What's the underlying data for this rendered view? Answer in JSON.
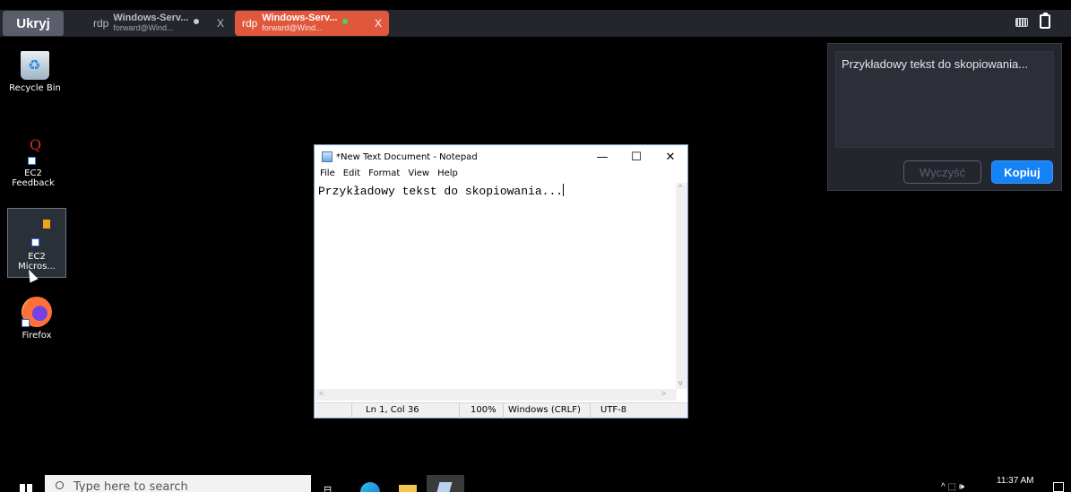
{
  "topbar": {
    "hide_label": "Ukryj",
    "tabs": [
      {
        "protocol": "rdp",
        "title": "Windows-Serv...",
        "subtitle": "forward@Wind...",
        "close": "X",
        "active": false
      },
      {
        "protocol": "rdp",
        "title": "Windows-Serv...",
        "subtitle": "forward@Wind...",
        "close": "X",
        "active": true
      }
    ],
    "colors": {
      "bar": "#24262d",
      "active_tab": "#e0573c",
      "connected_dot": "#3ed66a"
    }
  },
  "desktop": {
    "icons": [
      {
        "label": "Recycle Bin",
        "icon": "recycle-bin-icon"
      },
      {
        "label": "EC2 Feedback",
        "icon": "ec2-feedback-icon"
      },
      {
        "label": "EC2\nMicros...",
        "label_line1": "EC2",
        "label_line2": "Micros...",
        "icon": "ec2-package-icon",
        "selected": true
      },
      {
        "label": "Firefox",
        "icon": "firefox-icon"
      }
    ]
  },
  "notepad": {
    "title": "*New Text Document - Notepad",
    "controls": {
      "minimize": "—",
      "maximize": "☐",
      "close": "✕"
    },
    "menu": [
      "File",
      "Edit",
      "Format",
      "View",
      "Help"
    ],
    "content": "Przykładowy tekst do skopiowania...",
    "scroll": {
      "left": "<",
      "right": ">"
    },
    "status": {
      "position": "Ln 1, Col 36",
      "zoom": "100%",
      "line_ending": "Windows (CRLF)",
      "encoding": "UTF-8"
    }
  },
  "clipboard": {
    "text": "Przykładowy tekst do skopiowania...",
    "clear_label": "Wyczyść",
    "copy_label": "Kopiuj",
    "colors": {
      "copy_button": "#1583f6"
    }
  },
  "taskbar": {
    "search_placeholder": "Type here to search",
    "tray_icons": "^ ⬚ 🕪",
    "clock": "11:37 AM"
  }
}
